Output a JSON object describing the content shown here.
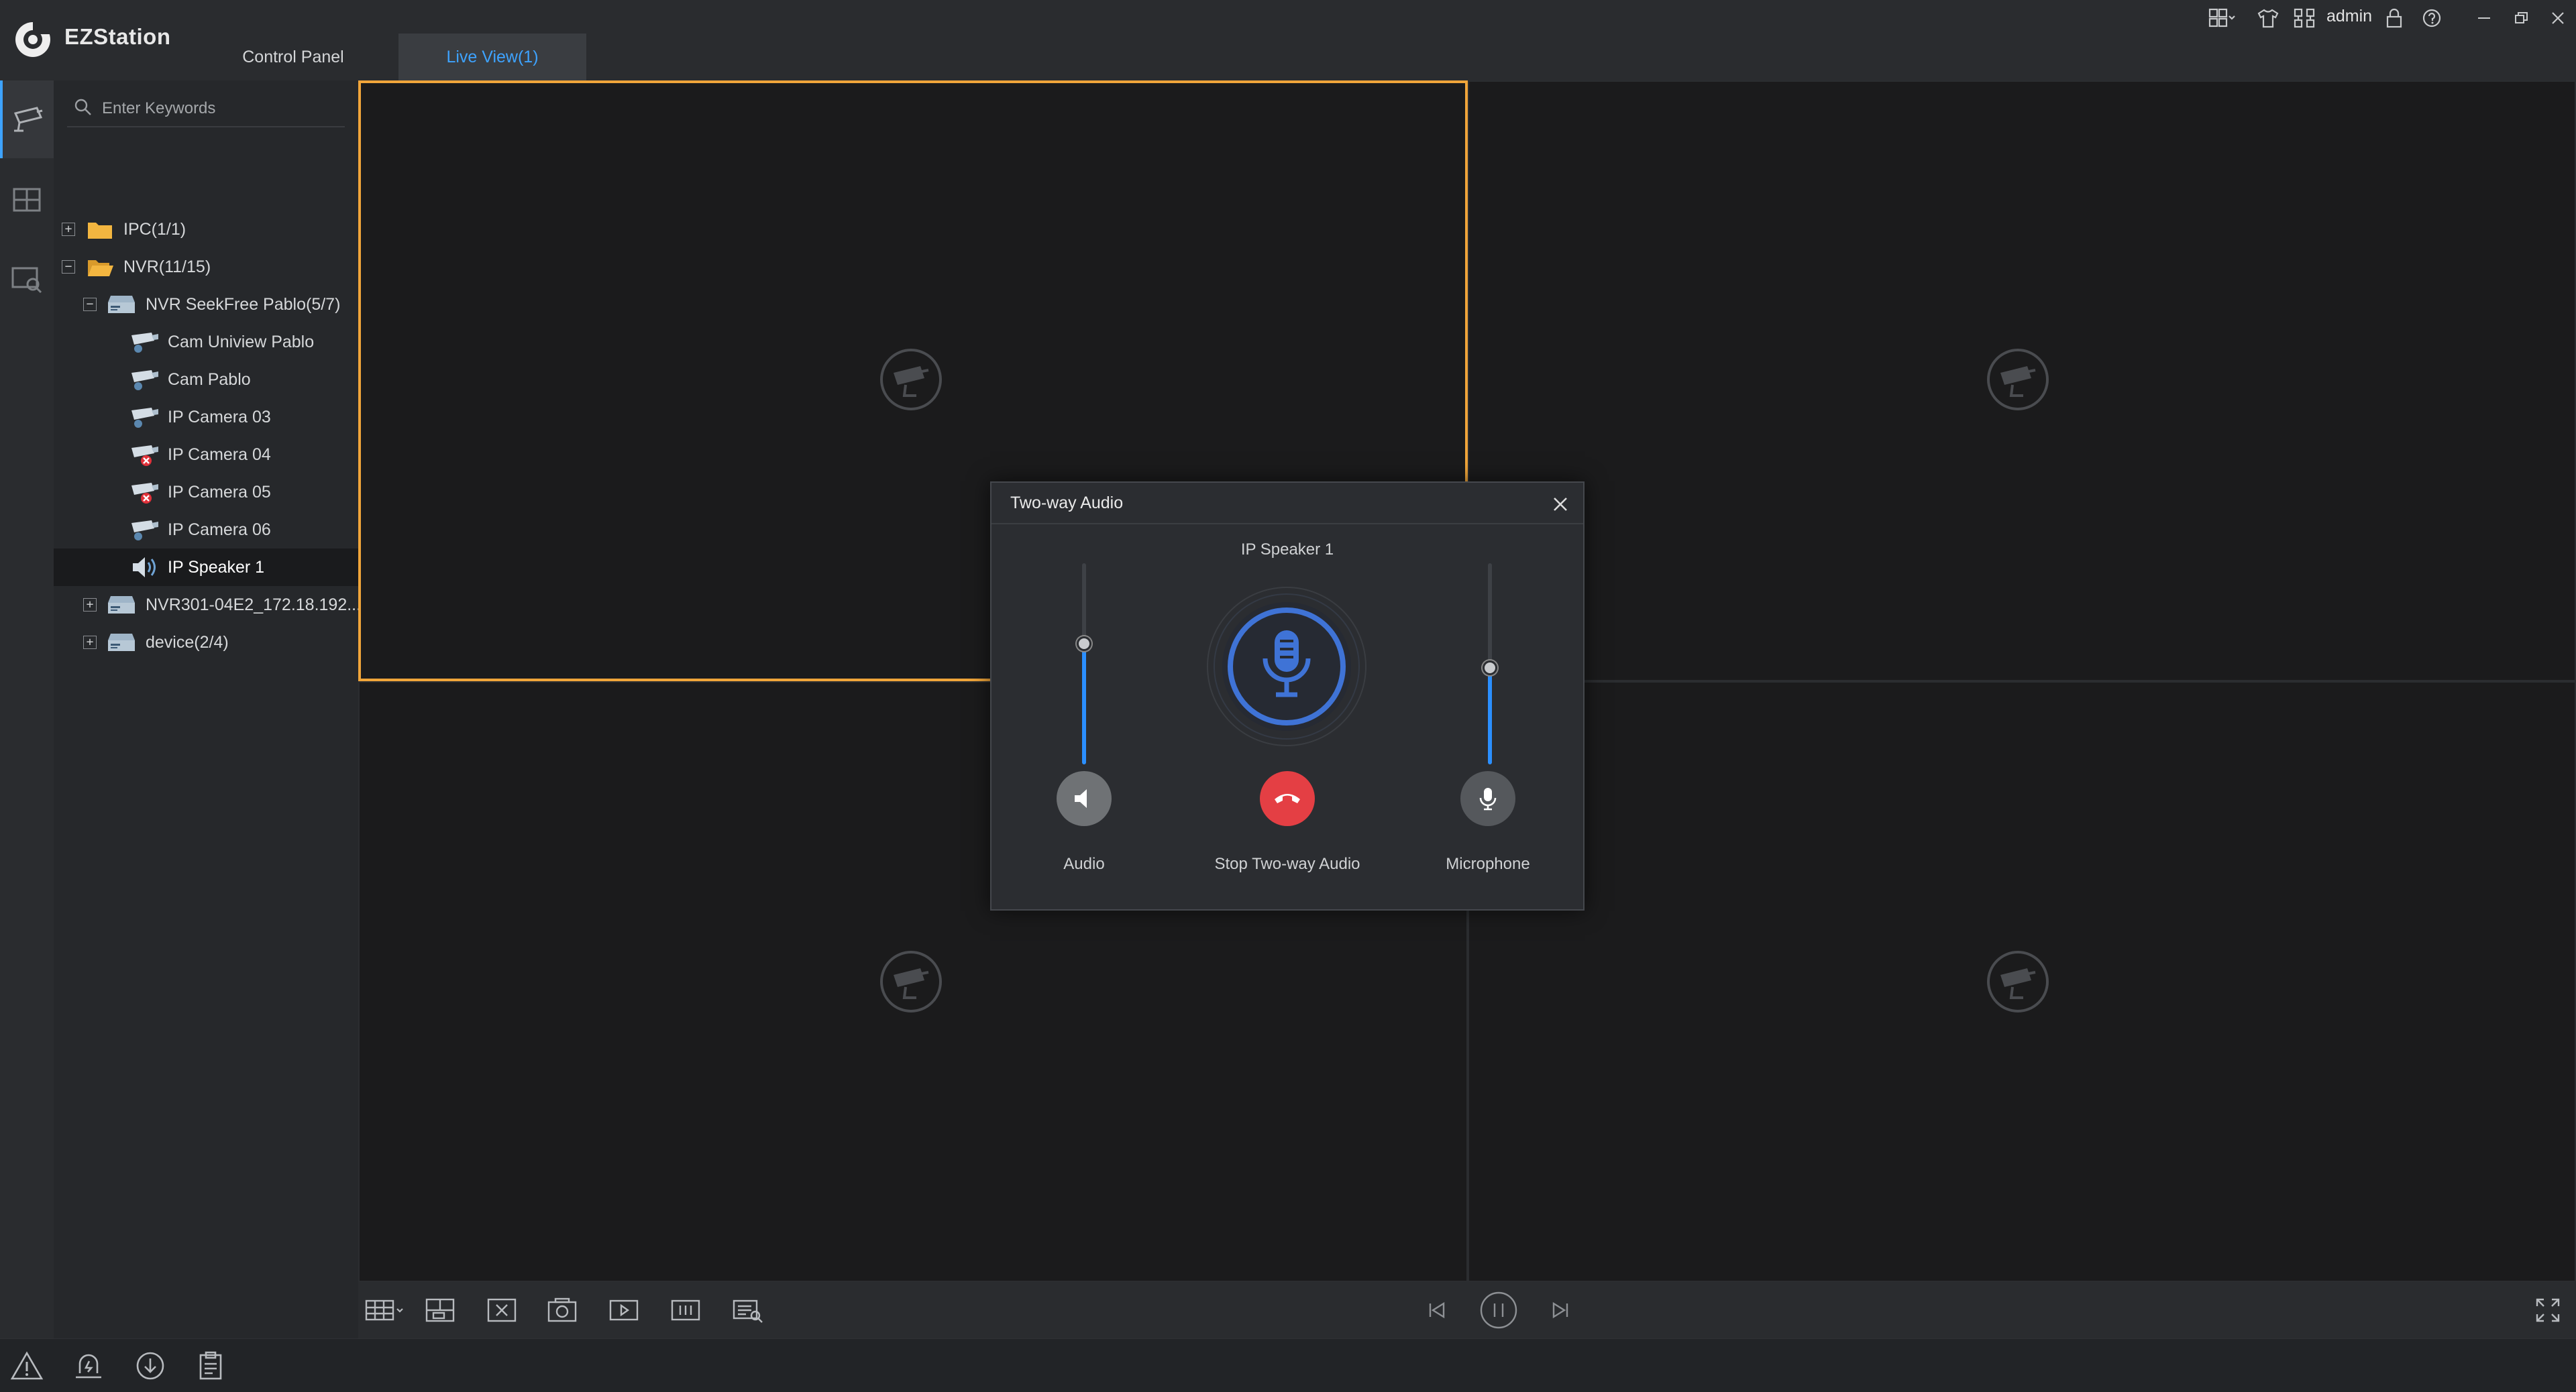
{
  "app": {
    "title": "EZStation"
  },
  "tabs": [
    {
      "label": "Control Panel",
      "active": false
    },
    {
      "label": "Live View(1)",
      "active": true
    }
  ],
  "header": {
    "username": "admin"
  },
  "search": {
    "placeholder": "Enter Keywords"
  },
  "tree": {
    "items": [
      {
        "label": "IPC(1/1)",
        "expander": "+",
        "icon": "folder-icon"
      },
      {
        "label": "NVR(11/15)",
        "expander": "−",
        "icon": "folder-open-icon"
      },
      {
        "label": "NVR SeekFree Pablo(5/7)",
        "expander": "−",
        "icon": "nvr-icon"
      },
      {
        "label": "Cam Uniview Pablo",
        "icon": "camera-icon"
      },
      {
        "label": "Cam Pablo",
        "icon": "camera-icon"
      },
      {
        "label": "IP Camera 03",
        "icon": "camera-icon"
      },
      {
        "label": "IP Camera 04",
        "icon": "camera-offline-icon"
      },
      {
        "label": "IP Camera 05",
        "icon": "camera-offline-icon"
      },
      {
        "label": "IP Camera 06",
        "icon": "camera-icon"
      },
      {
        "label": "IP Speaker 1",
        "icon": "speaker-icon",
        "selected": true
      },
      {
        "label": "NVR301-04E2_172.18.192....",
        "expander": "+",
        "icon": "nvr-icon"
      },
      {
        "label": "device(2/4)",
        "expander": "+",
        "icon": "nvr-icon"
      }
    ]
  },
  "dialog": {
    "title": "Two-way Audio",
    "device_name": "IP Speaker 1",
    "audio_label": "Audio",
    "stop_label": "Stop Two-way Audio",
    "mic_label": "Microphone",
    "audio_level": 0.6,
    "mic_level": 0.48
  },
  "colors": {
    "accent": "#3ea3ff",
    "selected_pane_border": "#f0a53a",
    "stop_button": "#e43f44",
    "slider_fill": "#2b8fff"
  }
}
